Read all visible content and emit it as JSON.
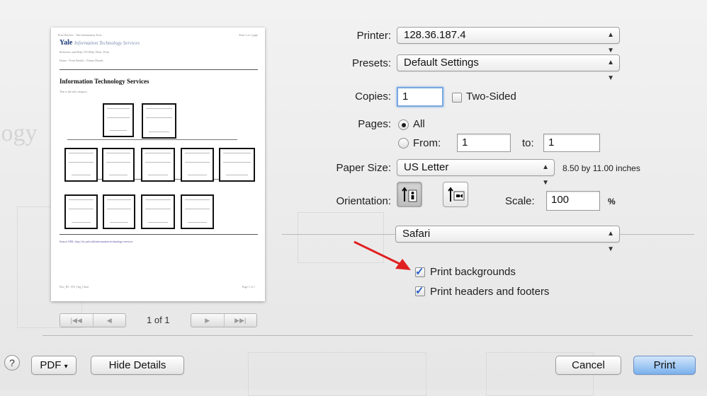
{
  "preview": {
    "header_left": "Print Preview - Yale Information Tech...",
    "header_right": "Print 1 of 1 page",
    "brand_name": "Yale",
    "brand_subtitle": "Information Technology Services",
    "line_1": "Reference and Help: ITS Help: Desk / Print",
    "line_2": "Home > Print Details > Printer Details",
    "page_title": "Information Technology Services",
    "intro": "This is the sub-category...",
    "source_url": "Source URL: http://its.yale.edu/information-technology-services",
    "footer_left": "Doc_ID : ITS_Org_Chart",
    "footer_right": "Page 1 of 1",
    "current_page": "1 of 1"
  },
  "form": {
    "printer_label": "Printer:",
    "printer_value": "128.36.187.4",
    "presets_label": "Presets:",
    "presets_value": "Default Settings",
    "copies_label": "Copies:",
    "copies_value": "1",
    "two_sided_label": "Two-Sided",
    "pages_label": "Pages:",
    "pages_all_label": "All",
    "pages_from_label": "From:",
    "pages_from_value": "1",
    "pages_to_label": "to:",
    "pages_to_value": "1",
    "paper_size_label": "Paper Size:",
    "paper_size_value": "US Letter",
    "paper_dimensions": "8.50 by 11.00 inches",
    "orientation_label": "Orientation:",
    "scale_label": "Scale:",
    "scale_value": "100",
    "scale_unit": "%",
    "section_value": "Safari",
    "print_backgrounds_label": "Print backgrounds",
    "print_headers_footers_label": "Print headers and footers"
  },
  "state": {
    "two_sided": false,
    "pages_mode": "all",
    "orientation": "portrait",
    "print_backgrounds": true,
    "print_headers_footers": true
  },
  "buttons": {
    "help": "?",
    "pdf": "PDF",
    "pdf_arrow": "▾",
    "hide_details": "Hide Details",
    "cancel": "Cancel",
    "print": "Print"
  },
  "nav_glyphs": {
    "first": "|◀◀",
    "prev": "◀",
    "next": "▶",
    "last": "▶▶|"
  },
  "colors": {
    "annotation_arrow": "#e02020",
    "primary_button": "#7ab1ec",
    "checkmark": "#2a5dc9"
  }
}
